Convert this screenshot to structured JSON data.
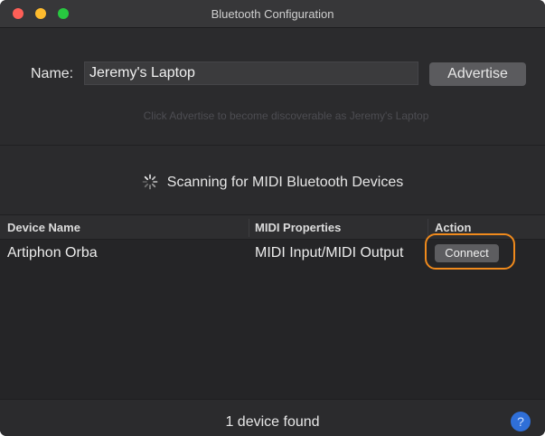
{
  "window": {
    "title": "Bluetooth Configuration"
  },
  "name_row": {
    "label": "Name:",
    "value": "Jeremy's Laptop",
    "advertise_label": "Advertise",
    "hint": "Click Advertise to become discoverable as Jeremy's Laptop"
  },
  "scan": {
    "icon": "spinner-icon",
    "text": "Scanning for MIDI Bluetooth Devices"
  },
  "table": {
    "headers": [
      "Device Name",
      "MIDI Properties",
      "Action"
    ],
    "rows": [
      {
        "device_name": "Artiphon Orba",
        "midi_properties": "MIDI Input/MIDI Output",
        "action_label": "Connect"
      }
    ]
  },
  "footer": {
    "status": "1 device found",
    "help_label": "?"
  },
  "colors": {
    "highlight": "#f08a1c",
    "help_accent": "#2f6fd8"
  }
}
